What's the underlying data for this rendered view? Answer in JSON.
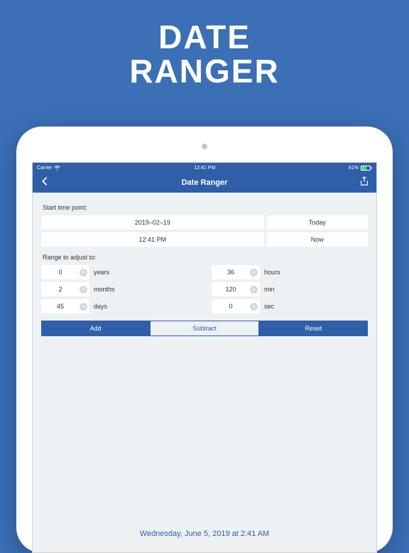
{
  "promo": {
    "line1": "DATE",
    "line2": "RANGER"
  },
  "statusbar": {
    "carrier": "Carrier",
    "time": "12:41 PM",
    "battery": "61%"
  },
  "navbar": {
    "title": "Date Ranger"
  },
  "start": {
    "label": "Start time point:",
    "date": "2019–02–19",
    "today": "Today",
    "time": "12:41 PM",
    "now": "Now"
  },
  "range": {
    "label": "Range to adjust to:",
    "left": [
      {
        "value": "0",
        "unit": "years"
      },
      {
        "value": "2",
        "unit": "months"
      },
      {
        "value": "45",
        "unit": "days"
      }
    ],
    "right": [
      {
        "value": "36",
        "unit": "hours"
      },
      {
        "value": "120",
        "unit": "min"
      },
      {
        "value": "0",
        "unit": "sec"
      }
    ]
  },
  "buttons": {
    "add": "Add",
    "subtract": "Subtract",
    "reset": "Reset"
  },
  "result": "Wednesday, June 5, 2019 at 2:41 AM"
}
